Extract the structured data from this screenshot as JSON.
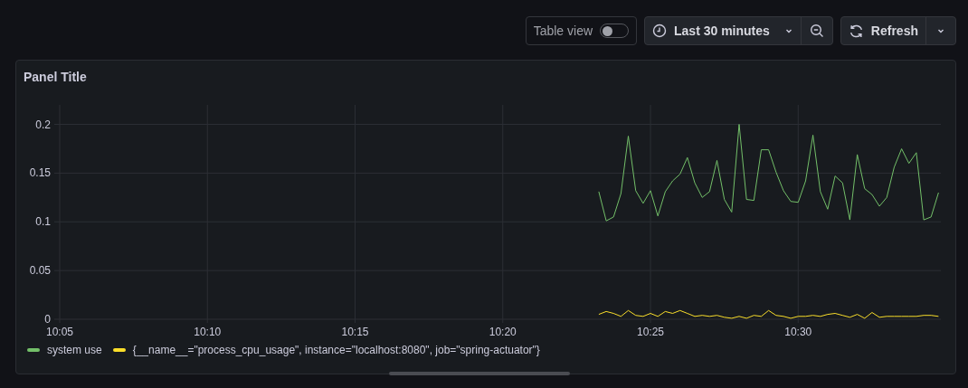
{
  "toolbar": {
    "table_view": {
      "label": "Table view",
      "on": false
    },
    "time_range": {
      "label": "Last 30 minutes"
    },
    "refresh": {
      "label": "Refresh"
    }
  },
  "panel": {
    "title": "Panel Title",
    "chart_data": {
      "type": "line",
      "categories": [
        "10:05",
        null,
        null,
        null,
        null,
        null,
        null,
        null,
        null,
        null,
        null,
        null,
        null,
        null,
        null,
        null,
        null,
        null,
        null,
        null,
        "10:10",
        null,
        null,
        null,
        null,
        null,
        null,
        null,
        null,
        null,
        null,
        null,
        null,
        null,
        null,
        null,
        null,
        null,
        null,
        null,
        "10:15",
        null,
        null,
        null,
        null,
        null,
        null,
        null,
        null,
        null,
        null,
        null,
        null,
        null,
        null,
        null,
        null,
        null,
        null,
        null,
        "10:20",
        null,
        null,
        null,
        null,
        null,
        null,
        null,
        null,
        null,
        null,
        null,
        null,
        null,
        null,
        null,
        null,
        null,
        null,
        null,
        "10:25",
        null,
        null,
        null,
        null,
        null,
        null,
        null,
        null,
        null,
        null,
        null,
        null,
        null,
        null,
        null,
        null,
        null,
        null,
        null,
        "10:30",
        null,
        null,
        null,
        null,
        null,
        null,
        null,
        null,
        null,
        null,
        null,
        null,
        null,
        null,
        null,
        null,
        null,
        null,
        null
      ],
      "series": [
        {
          "name": "system use",
          "color": "#73bf69",
          "values": [
            null,
            null,
            null,
            null,
            null,
            null,
            null,
            null,
            null,
            null,
            null,
            null,
            null,
            null,
            null,
            null,
            null,
            null,
            null,
            null,
            null,
            null,
            null,
            null,
            null,
            null,
            null,
            null,
            null,
            null,
            null,
            null,
            null,
            null,
            null,
            null,
            null,
            null,
            null,
            null,
            null,
            null,
            null,
            null,
            null,
            null,
            null,
            null,
            null,
            null,
            null,
            null,
            null,
            null,
            null,
            null,
            null,
            null,
            null,
            null,
            null,
            null,
            null,
            null,
            null,
            null,
            null,
            null,
            null,
            null,
            null,
            null,
            null,
            0.131,
            0.101,
            0.105,
            0.129,
            0.188,
            0.132,
            0.119,
            0.132,
            0.106,
            0.131,
            0.142,
            0.149,
            0.166,
            0.14,
            0.125,
            0.131,
            0.163,
            0.123,
            0.11,
            0.2,
            0.123,
            0.122,
            0.174,
            0.174,
            0.151,
            0.132,
            0.121,
            0.12,
            0.142,
            0.189,
            0.131,
            0.113,
            0.147,
            0.14,
            0.102,
            0.169,
            0.134,
            0.128,
            0.116,
            0.125,
            0.156,
            0.175,
            0.16,
            0.171,
            0.102,
            0.105,
            0.13
          ]
        },
        {
          "name": "{__name__=\"process_cpu_usage\", instance=\"localhost:8080\", job=\"spring-actuator\"}",
          "color": "#fade2a",
          "values": [
            null,
            null,
            null,
            null,
            null,
            null,
            null,
            null,
            null,
            null,
            null,
            null,
            null,
            null,
            null,
            null,
            null,
            null,
            null,
            null,
            null,
            null,
            null,
            null,
            null,
            null,
            null,
            null,
            null,
            null,
            null,
            null,
            null,
            null,
            null,
            null,
            null,
            null,
            null,
            null,
            null,
            null,
            null,
            null,
            null,
            null,
            null,
            null,
            null,
            null,
            null,
            null,
            null,
            null,
            null,
            null,
            null,
            null,
            null,
            null,
            null,
            null,
            null,
            null,
            null,
            null,
            null,
            null,
            null,
            null,
            null,
            null,
            null,
            0.005,
            0.008,
            0.006,
            0.003,
            0.009,
            0.004,
            0.003,
            0.006,
            0.003,
            0.008,
            0.006,
            0.009,
            0.006,
            0.003,
            0.004,
            0.003,
            0.004,
            0.002,
            0.001,
            0.003,
            0.001,
            0.004,
            0.003,
            0.009,
            0.004,
            0.003,
            0.001,
            0.003,
            0.003,
            0.004,
            0.003,
            0.005,
            0.006,
            0.004,
            0.002,
            0.005,
            0.001,
            0.007,
            0.002,
            0.003,
            0.003,
            0.003,
            0.003,
            0.003,
            0.004,
            0.004,
            0.003
          ]
        }
      ],
      "grid": true,
      "ylim": [
        0,
        0.22
      ],
      "yticks": [
        {
          "value": 0,
          "label": "0"
        },
        {
          "value": 0.05,
          "label": "0.05"
        },
        {
          "value": 0.1,
          "label": "0.1"
        },
        {
          "value": 0.15,
          "label": "0.15"
        },
        {
          "value": 0.2,
          "label": "0.2"
        }
      ]
    }
  }
}
